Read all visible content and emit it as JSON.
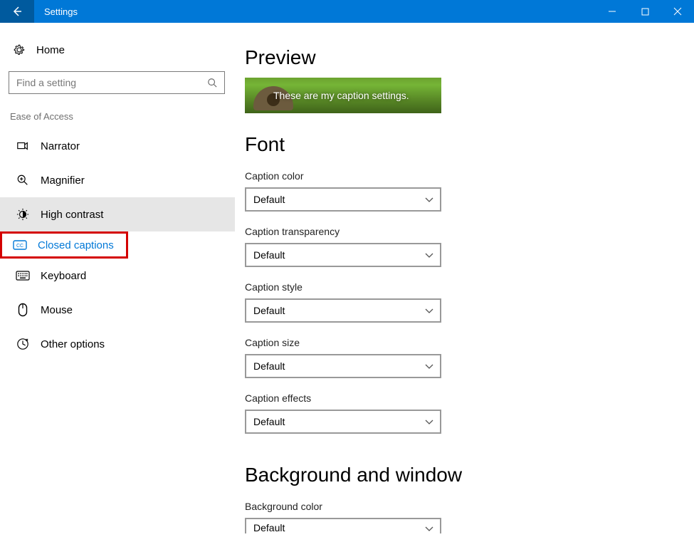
{
  "window": {
    "title": "Settings"
  },
  "sidebar": {
    "home": "Home",
    "search_placeholder": "Find a setting",
    "category": "Ease of Access",
    "items": [
      {
        "icon": "narrator-icon",
        "label": "Narrator"
      },
      {
        "icon": "magnifier-icon",
        "label": "Magnifier"
      },
      {
        "icon": "high-contrast-icon",
        "label": "High contrast"
      },
      {
        "icon": "closed-captions-icon",
        "label": "Closed captions"
      },
      {
        "icon": "keyboard-icon",
        "label": "Keyboard"
      },
      {
        "icon": "mouse-icon",
        "label": "Mouse"
      },
      {
        "icon": "other-options-icon",
        "label": "Other options"
      }
    ]
  },
  "main": {
    "preview_heading": "Preview",
    "preview_text": "These are my caption settings.",
    "font_heading": "Font",
    "fields": [
      {
        "label": "Caption color",
        "value": "Default"
      },
      {
        "label": "Caption transparency",
        "value": "Default"
      },
      {
        "label": "Caption style",
        "value": "Default"
      },
      {
        "label": "Caption size",
        "value": "Default"
      },
      {
        "label": "Caption effects",
        "value": "Default"
      }
    ],
    "bg_heading": "Background and window",
    "bg_field": {
      "label": "Background color",
      "value": "Default"
    }
  }
}
